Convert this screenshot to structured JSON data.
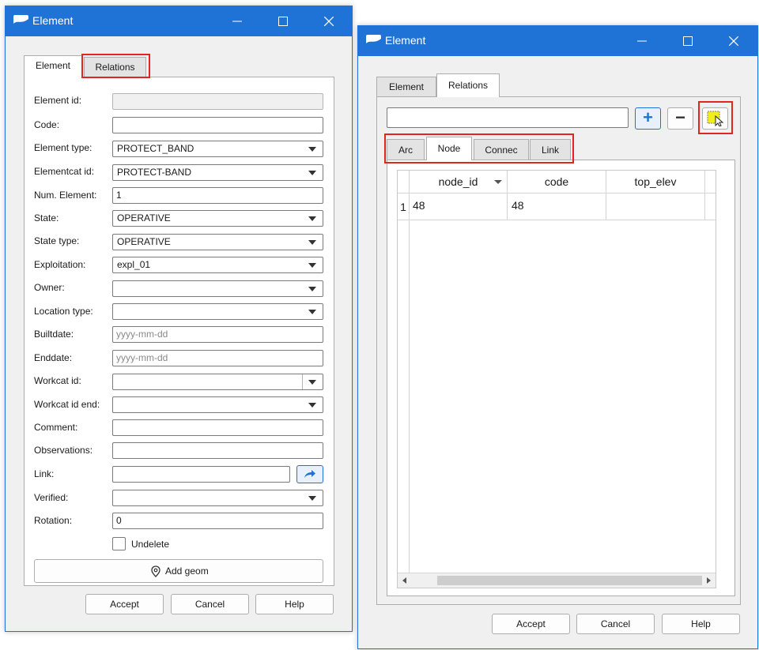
{
  "left_window": {
    "title": "Element",
    "tabs": [
      {
        "label": "Element"
      },
      {
        "label": "Relations"
      }
    ],
    "fields": {
      "element_id": {
        "label": "Element id:",
        "value": ""
      },
      "code": {
        "label": "Code:",
        "value": ""
      },
      "element_type": {
        "label": "Element type:",
        "value": "PROTECT_BAND"
      },
      "elementcat_id": {
        "label": "Elementcat id:",
        "value": "PROTECT-BAND"
      },
      "num_element": {
        "label": "Num. Element:",
        "value": "1"
      },
      "state": {
        "label": "State:",
        "value": "OPERATIVE"
      },
      "state_type": {
        "label": "State type:",
        "value": "OPERATIVE"
      },
      "exploitation": {
        "label": "Exploitation:",
        "value": "expl_01"
      },
      "owner": {
        "label": "Owner:",
        "value": ""
      },
      "location_type": {
        "label": "Location type:",
        "value": ""
      },
      "builtdate": {
        "label": "Builtdate:",
        "placeholder": "yyyy-mm-dd"
      },
      "enddate": {
        "label": "Enddate:",
        "placeholder": "yyyy-mm-dd"
      },
      "workcat_id": {
        "label": "Workcat id:",
        "value": ""
      },
      "workcat_id_end": {
        "label": "Workcat id end:",
        "value": ""
      },
      "comment": {
        "label": "Comment:",
        "value": ""
      },
      "observations": {
        "label": "Observations:",
        "value": ""
      },
      "link": {
        "label": "Link:",
        "value": ""
      },
      "verified": {
        "label": "Verified:",
        "value": ""
      },
      "rotation": {
        "label": "Rotation:",
        "value": "0"
      }
    },
    "undelete_label": "Undelete",
    "add_geom_label": "Add geom",
    "buttons": {
      "accept": "Accept",
      "cancel": "Cancel",
      "help": "Help"
    }
  },
  "right_window": {
    "title": "Element",
    "tabs": [
      {
        "label": "Element"
      },
      {
        "label": "Relations"
      }
    ],
    "search_value": "",
    "add_symbol": "+",
    "remove_symbol": "−",
    "sub_tabs": [
      {
        "label": "Arc"
      },
      {
        "label": "Node"
      },
      {
        "label": "Connec"
      },
      {
        "label": "Link"
      }
    ],
    "table": {
      "columns": [
        "node_id",
        "code",
        "top_elev"
      ],
      "rows": [
        {
          "index": "1",
          "cells": [
            "48",
            "48",
            ""
          ]
        }
      ]
    },
    "buttons": {
      "accept": "Accept",
      "cancel": "Cancel",
      "help": "Help"
    }
  },
  "colors": {
    "titlebar": "#1f73d6",
    "highlight": "#e0261f",
    "selector_icon": "#f2ee1c",
    "link_button": "#1f73d6"
  }
}
